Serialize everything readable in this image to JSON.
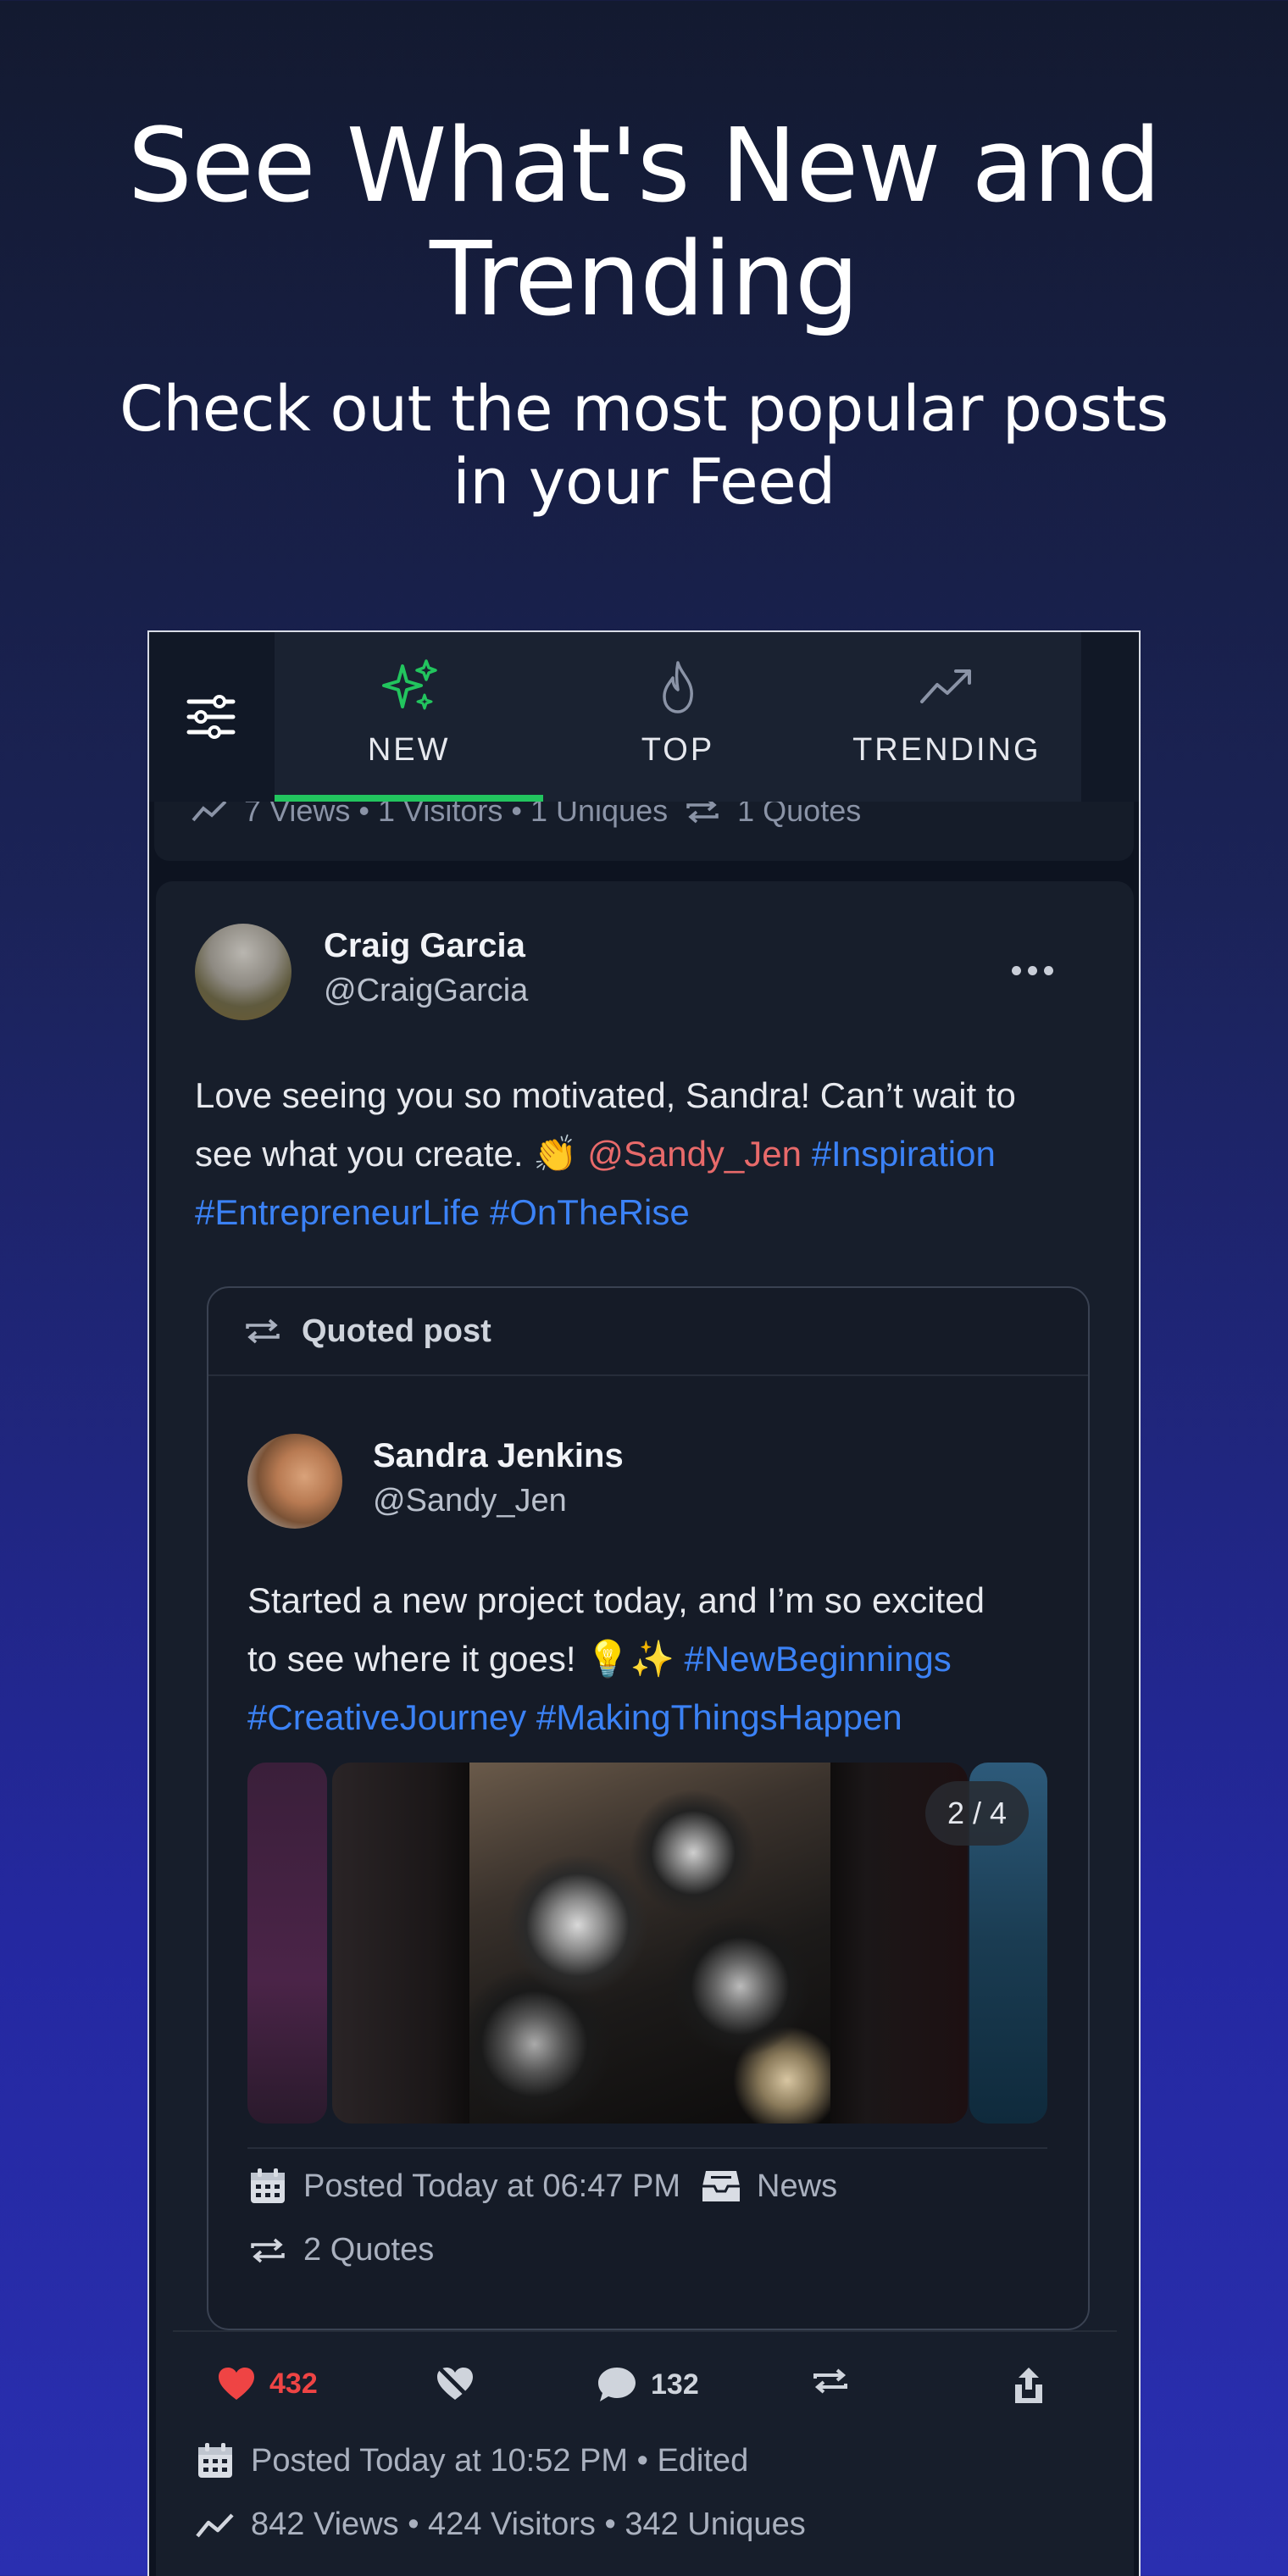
{
  "hero": {
    "title_line1": "See What's New and",
    "title_line2": "Trending",
    "subtitle_line1": "Check out the most popular posts",
    "subtitle_line2": "in your Feed"
  },
  "tabs": [
    {
      "label": "NEW",
      "icon": "sparkles-icon",
      "active": true
    },
    {
      "label": "TOP",
      "icon": "flame-icon",
      "active": false
    },
    {
      "label": "TRENDING",
      "icon": "trending-up-icon",
      "active": false
    }
  ],
  "previous_post": {
    "stats": "7 Views • 1 Visitors • 1 Uniques",
    "quotes": "1 Quotes"
  },
  "post": {
    "author_name": "Craig Garcia",
    "author_handle": "@CraigGarcia",
    "text_line1": "Love seeing you so motivated, Sandra! Can’t wait to",
    "text_line2_plain": "see what you create. 👏 ",
    "mention": "@Sandy_Jen",
    "hashtag1": "#Inspiration",
    "hashtag2": "#EntrepreneurLife",
    "hashtag3": "#OnTheRise",
    "likes": "432",
    "comments": "132",
    "posted": "Posted Today at 10:52 PM • Edited",
    "stats": "842 Views • 424 Visitors • 342 Uniques"
  },
  "quoted": {
    "header": "Quoted post",
    "author_name": "Sandra Jenkins",
    "author_handle": "@Sandy_Jen",
    "text_line1": "Started a new project today, and I’m so excited",
    "text_line2_plain": "to see where it goes! 💡✨ ",
    "hashtag1": "#NewBeginnings",
    "hashtag2": "#CreativeJourney",
    "hashtag3": "#MakingThingsHappen",
    "carousel_counter": "2 / 4",
    "posted": "Posted Today at 06:47 PM",
    "category": "News",
    "quotes": "2 Quotes"
  },
  "colors": {
    "accent_green": "#22c55e",
    "like_red": "#ef4444",
    "mention": "#e86a6a",
    "hashtag": "#3b82f6"
  }
}
